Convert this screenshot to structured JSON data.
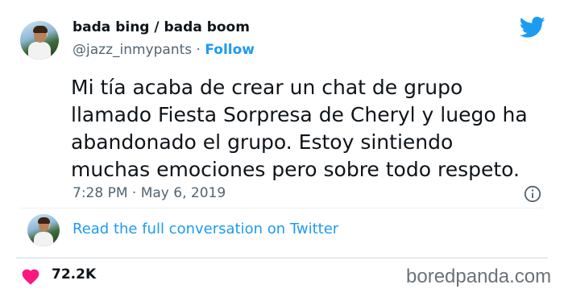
{
  "user": {
    "display_name": "bada bing / bada boom",
    "handle": "@jazz_inmypants",
    "separator": "·",
    "follow_label": "Follow"
  },
  "tweet": {
    "lines": [
      "Mi tía acaba de crear un chat de grupo",
      "llamado Fiesta Sorpresa de Cheryl y luego ha",
      "abandonado el grupo. Estoy sintiendo",
      "muchas emociones pero sobre todo respeto."
    ],
    "timestamp": "7:28 PM · May 6, 2019"
  },
  "conversation_link": "Read the full conversation on Twitter",
  "likes": "72.2K",
  "watermark": "boredpanda.com",
  "colors": {
    "twitter_blue": "#1d9bf0",
    "heart": "#f91880",
    "secondary_text": "#536471"
  },
  "icons": [
    "twitter-bird-icon",
    "info-icon",
    "heart-icon"
  ]
}
